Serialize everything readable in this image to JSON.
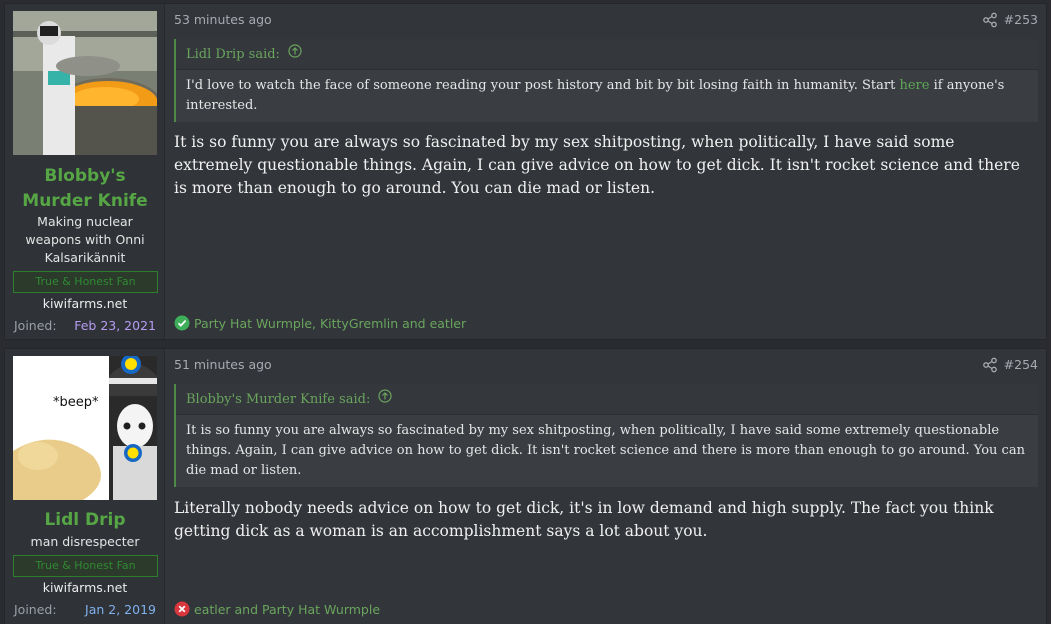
{
  "posts": [
    {
      "author": "Blobby's Murder Knife",
      "author_line1": "Blobby's",
      "author_line2": "Murder Knife",
      "user_title_lines": [
        "Making nuclear",
        "weapons with Onni",
        "Kalsarikännit"
      ],
      "banner": "True & Honest Fan",
      "site": "kiwifarms.net",
      "joined_label": "Joined:",
      "joined_date": "Feb 23, 2021",
      "joined_color": "#b69cf2",
      "time": "53 minutes ago",
      "number": "#253",
      "quote_author": "Lidl Drip said:",
      "quote_text_before": "I'd love to watch the face of someone reading your post history and bit by bit losing faith in humanity. Start ",
      "quote_link": "here",
      "quote_text_after": " if anyone's interested.",
      "message": "It is so funny you are always so fascinated by my sex shitposting, when politically, I have said some extremely questionable things. Again, I can give advice on how to get dick. It isn't rocket science and there is more than enough to go around. You can die mad or listen.",
      "reaction_icon": "check-icon",
      "reaction_color": "#3fae5a",
      "reactions": "Party Hat Wurmple, KittyGremlin and eatler"
    },
    {
      "author": "Lidl Drip",
      "user_title": "man disrespecter",
      "banner": "True & Honest Fan",
      "site": "kiwifarms.net",
      "joined_label": "Joined:",
      "joined_date": "Jan 2, 2019",
      "joined_color": "#7fb1ec",
      "avatar_text": "*beep*",
      "avatar_badge": "LIDL",
      "time": "51 minutes ago",
      "number": "#254",
      "quote_author": "Blobby's Murder Knife said:",
      "quote_text": "It is so funny you are always so fascinated by my sex shitposting, when politically, I have said some extremely questionable things. Again, I can give advice on how to get dick. It isn't rocket science and there is more than enough to go around. You can die mad or listen.",
      "message": "Literally nobody needs advice on how to get dick, it's in low demand and high supply. The fact you think getting dick as a woman is an accomplishment says a lot about you.",
      "reaction_icon": "x-icon",
      "reaction_color": "#d9363e",
      "reactions": "eatler and Party Hat Wurmple"
    }
  ]
}
